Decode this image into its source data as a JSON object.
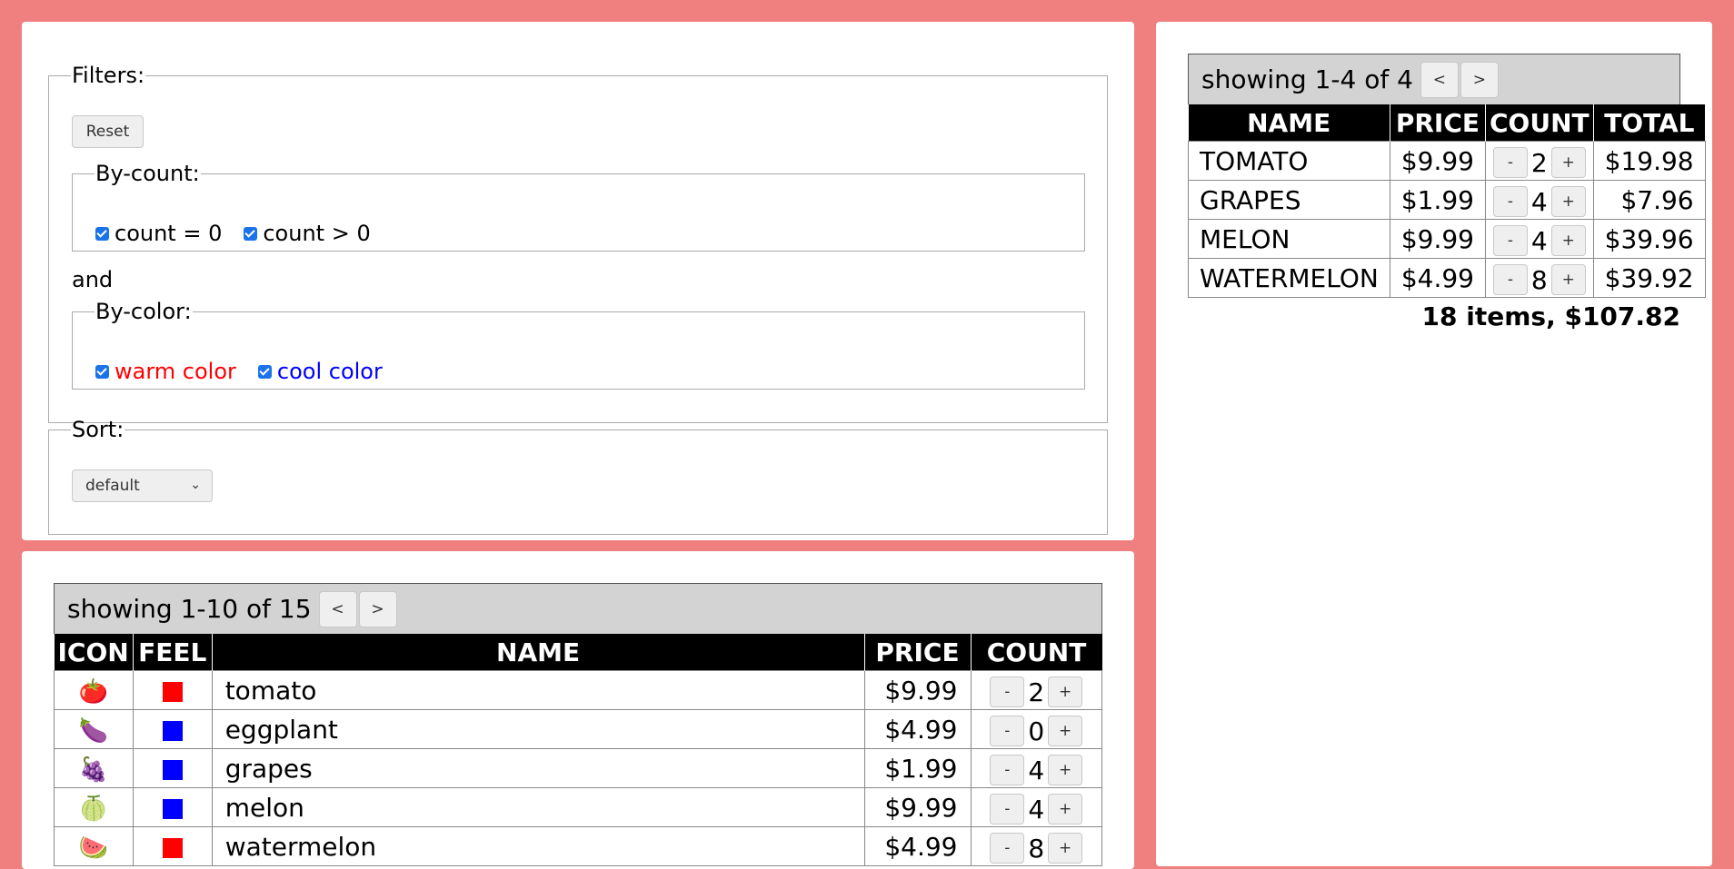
{
  "filters": {
    "legend": "Filters:",
    "reset_label": "Reset",
    "and_label": "and",
    "by_count": {
      "legend": "By-count:",
      "options": [
        {
          "label": "count = 0",
          "checked": true
        },
        {
          "label": "count > 0",
          "checked": true
        }
      ]
    },
    "by_color": {
      "legend": "By-color:",
      "options": [
        {
          "label": "warm color",
          "checked": true,
          "color": "#ff0000"
        },
        {
          "label": "cool color",
          "checked": true,
          "color": "#0000ff"
        }
      ]
    }
  },
  "sort": {
    "legend": "Sort:",
    "selected": "default"
  },
  "catalog": {
    "pager_text": "showing 1-10 of 15",
    "prev_label": "<",
    "next_label": ">",
    "columns": [
      "ICON",
      "FEEL",
      "NAME",
      "PRICE",
      "COUNT"
    ],
    "rows": [
      {
        "icon": "🍅",
        "icon_name": "tomato-icon",
        "feel_color": "#ff0000",
        "name": "tomato",
        "price": "$9.99",
        "count": "2"
      },
      {
        "icon": "🍆",
        "icon_name": "eggplant-icon",
        "feel_color": "#0000ff",
        "name": "eggplant",
        "price": "$4.99",
        "count": "0"
      },
      {
        "icon": "🍇",
        "icon_name": "grapes-icon",
        "feel_color": "#0000ff",
        "name": "grapes",
        "price": "$1.99",
        "count": "4"
      },
      {
        "icon": "🍈",
        "icon_name": "melon-icon",
        "feel_color": "#0000ff",
        "name": "melon",
        "price": "$9.99",
        "count": "4"
      },
      {
        "icon": "🍉",
        "icon_name": "watermelon-icon",
        "feel_color": "#ff0000",
        "name": "watermelon",
        "price": "$4.99",
        "count": "8"
      }
    ]
  },
  "cart": {
    "pager_text": "showing 1-4 of 4",
    "prev_label": "<",
    "next_label": ">",
    "columns": [
      "NAME",
      "PRICE",
      "COUNT",
      "TOTAL"
    ],
    "rows": [
      {
        "name": "TOMATO",
        "price": "$9.99",
        "count": "2",
        "total": "$19.98"
      },
      {
        "name": "GRAPES",
        "price": "$1.99",
        "count": "4",
        "total": "$7.96"
      },
      {
        "name": "MELON",
        "price": "$9.99",
        "count": "4",
        "total": "$39.96"
      },
      {
        "name": "WATERMELON",
        "price": "$4.99",
        "count": "8",
        "total": "$39.92"
      }
    ],
    "summary": "18 items, $107.82"
  },
  "counter_labels": {
    "minus": "-",
    "plus": "+"
  },
  "colors": {
    "background": "#f08080",
    "header": "#000000",
    "pager": "#d3d3d3",
    "checkbox": "#1a73e8"
  }
}
